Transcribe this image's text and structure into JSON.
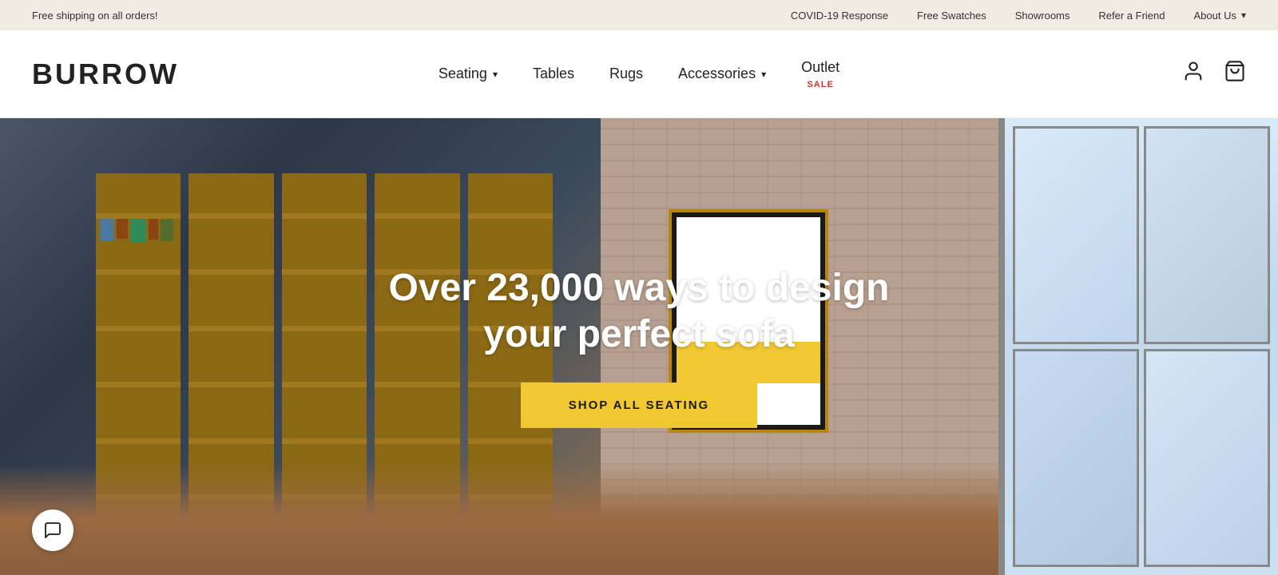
{
  "topBanner": {
    "shipping": "Free shipping on all orders!",
    "links": [
      {
        "id": "covid",
        "label": "COVID-19 Response"
      },
      {
        "id": "swatches",
        "label": "Free Swatches"
      },
      {
        "id": "showrooms",
        "label": "Showrooms"
      },
      {
        "id": "refer",
        "label": "Refer a Friend"
      },
      {
        "id": "about",
        "label": "About Us"
      }
    ]
  },
  "nav": {
    "logo": "BURROW",
    "links": [
      {
        "id": "seating",
        "label": "Seating",
        "hasDropdown": true
      },
      {
        "id": "tables",
        "label": "Tables",
        "hasDropdown": false
      },
      {
        "id": "rugs",
        "label": "Rugs",
        "hasDropdown": false
      },
      {
        "id": "accessories",
        "label": "Accessories",
        "hasDropdown": true
      },
      {
        "id": "outlet",
        "label": "Outlet",
        "hasDropdown": false,
        "badge": "SALE"
      }
    ],
    "accountIconLabel": "account",
    "cartIconLabel": "cart"
  },
  "hero": {
    "title": "Over 23,000 ways to design your perfect sofa",
    "ctaLabel": "SHOP ALL SEATING",
    "chatIcon": "💬"
  },
  "colors": {
    "accent": "#f0c832",
    "saleBadge": "#c0392b",
    "topBannerBg": "#f0ebe3"
  }
}
